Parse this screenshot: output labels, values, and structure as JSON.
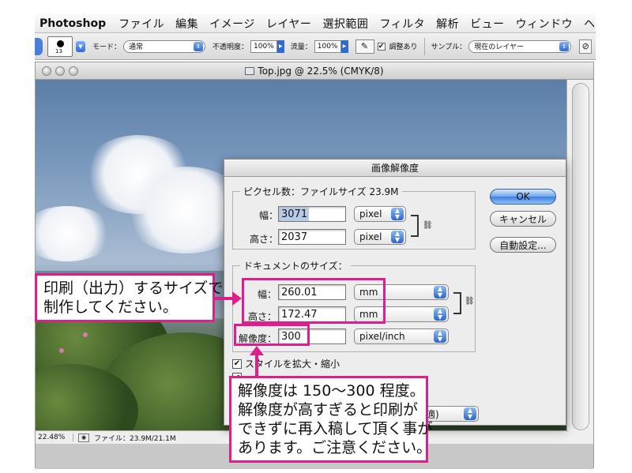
{
  "menubar": {
    "app": "Photoshop",
    "items": [
      "ファイル",
      "編集",
      "イメージ",
      "レイヤー",
      "選択範囲",
      "フィルタ",
      "解析",
      "ビュー",
      "ウィンドウ",
      "ヘ"
    ]
  },
  "options": {
    "brush_size": "13",
    "mode_label": "モード：",
    "mode_value": "通常",
    "opacity_label": "不透明度：",
    "opacity_value": "100%",
    "flow_label": "流量：",
    "flow_value": "100%",
    "align_label": "調整あり",
    "sample_label": "サンプル：",
    "sample_value": "現在のレイヤー"
  },
  "document": {
    "title": "Top.jpg @ 22.5% (CMYK/8)",
    "zoom": "22.48%",
    "file_info": "ファイル：23.9M/21.1M"
  },
  "dialog": {
    "title": "画像解像度",
    "pixel_group": "ピクセル数：ファイルサイズ 23.9M",
    "width_label": "幅：",
    "width_px": "3071",
    "height_label": "高さ：",
    "height_px": "2037",
    "pixel_unit": "pixel",
    "doc_group": "ドキュメントのサイズ：",
    "width_mm": "260.01",
    "height_mm": "172.47",
    "mm_unit": "mm",
    "resolution_label": "解像度：",
    "resolution_value": "300",
    "resolution_unit": "pixel/inch",
    "ok": "OK",
    "cancel": "キャンセル",
    "auto": "自動設定...",
    "scale_styles": "スタイルを拡大・縮小",
    "resample_partial": "最適)"
  },
  "annotations": {
    "print_size_line1": "印刷（出力）するサイズで",
    "print_size_line2": "制作してください。",
    "res_note_line1": "解像度は 150〜300 程度。",
    "res_note_line2": "解像度が高すぎると印刷が",
    "res_note_line3": "できずに再入稿して頂く事が",
    "res_note_line4": "あります。ご注意ください。"
  },
  "colors": {
    "annotation": "#dd1f8c",
    "accent_blue": "#2d6bd0"
  }
}
